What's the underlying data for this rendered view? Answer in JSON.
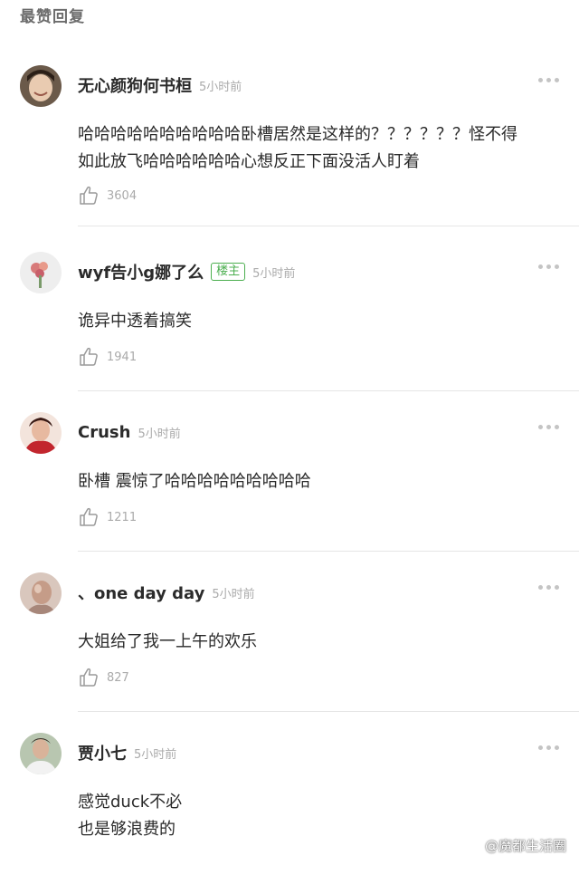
{
  "section_title": "最赞回复",
  "comments": [
    {
      "username": "无心颜狗何书桓",
      "badge": "",
      "time": "5小时前",
      "content_lines": [
        "哈哈哈哈哈哈哈哈哈哈卧槽居然是这样的？？？？？？怪不得",
        "如此放飞哈哈哈哈哈哈心想反正下面没活人盯着"
      ],
      "likes": "3604"
    },
    {
      "username": "wyf告小g娜了么",
      "badge": "楼主",
      "time": "5小时前",
      "content_lines": [
        "诡异中透着搞笑"
      ],
      "likes": "1941"
    },
    {
      "username": "Crush",
      "badge": "",
      "time": "5小时前",
      "content_lines": [
        "卧槽 震惊了哈哈哈哈哈哈哈哈哈"
      ],
      "likes": "1211"
    },
    {
      "username": "、one day day",
      "badge": "",
      "time": "5小时前",
      "content_lines": [
        "大姐给了我一上午的欢乐"
      ],
      "likes": "827"
    },
    {
      "username": "贾小七",
      "badge": "",
      "time": "5小时前",
      "content_lines": [
        "感觉duck不必",
        "也是够浪费的"
      ],
      "likes": ""
    }
  ],
  "watermark": "@魔都生活圈",
  "colors": {
    "badge_green": "#4caf50",
    "meta_gray": "#aaaaaa",
    "divider": "#e6e6e6"
  }
}
